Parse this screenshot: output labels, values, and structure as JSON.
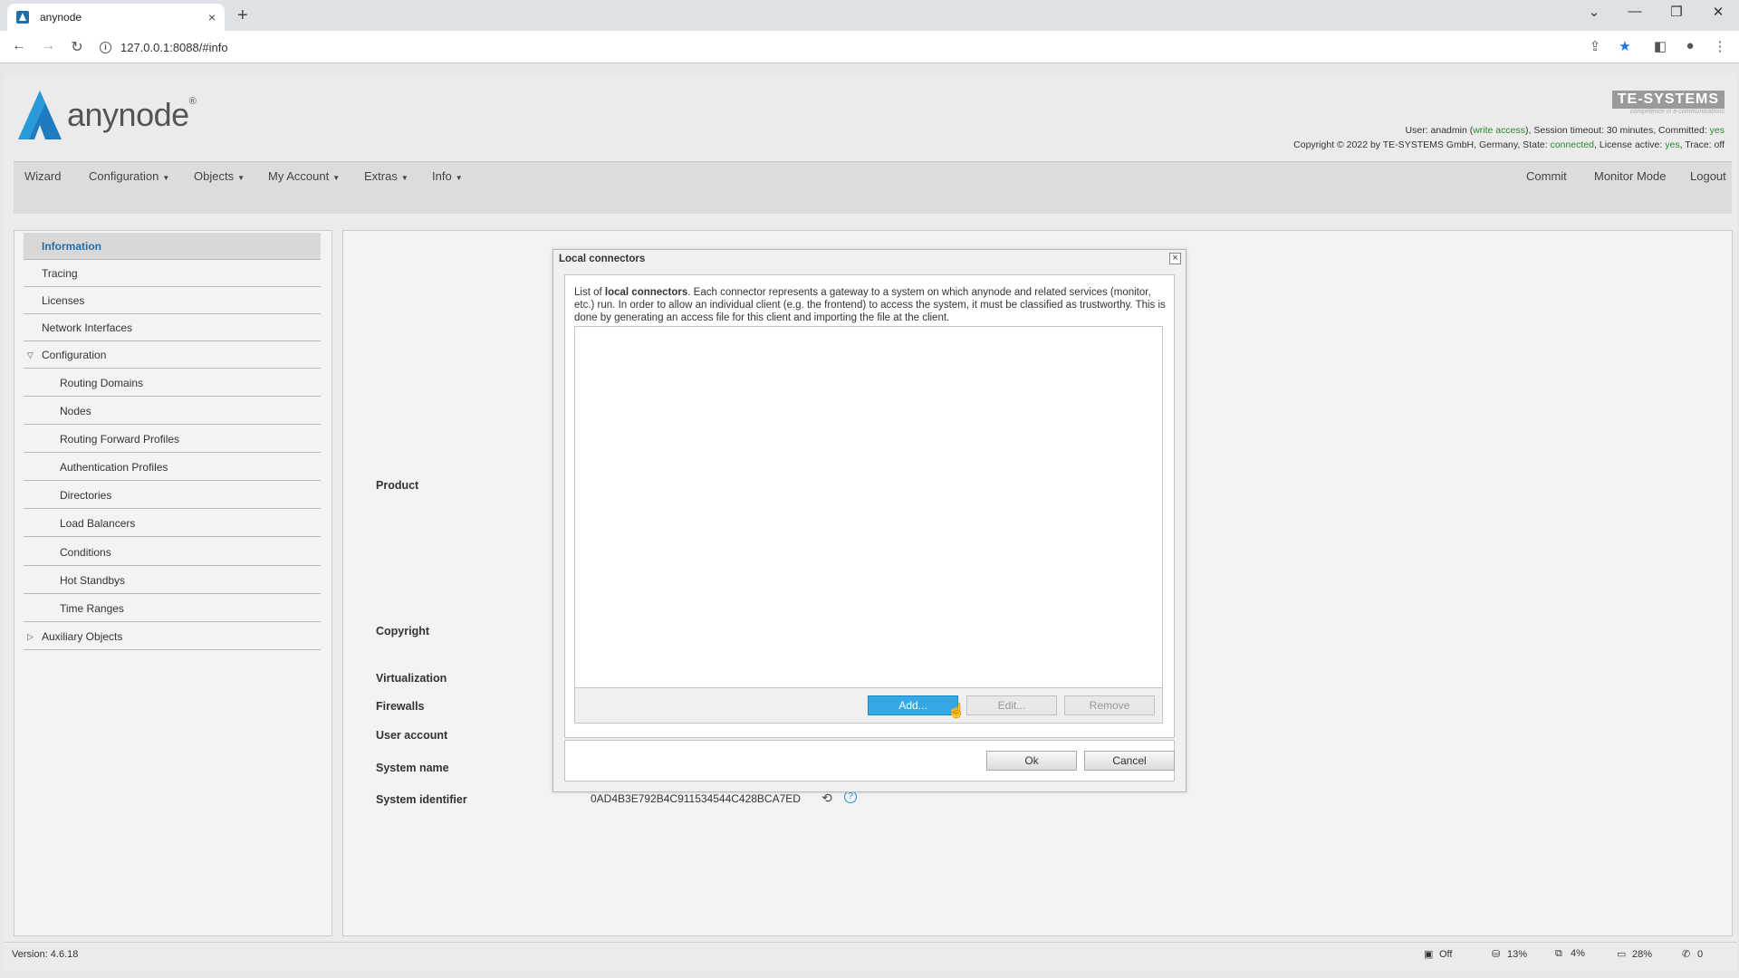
{
  "browser": {
    "tab_title": "anynode",
    "tab_close": "×",
    "new_tab": "+",
    "url": "127.0.0.1:8088/#info",
    "win_min": "—",
    "win_restore": "❐",
    "win_close": "✕",
    "tab_list": "⌄"
  },
  "header": {
    "logo_text": "anynode",
    "logo_reg": "®",
    "te_name": "TE-SYSTEMS",
    "te_tagline": "competence in e-communications",
    "status_line1_prefix": "User: anadmin (",
    "write_access": "write access",
    "status_line1_mid": "), Session timeout: 30 minutes, Committed: ",
    "committed_value": "yes",
    "status_line2_prefix": "Copyright © 2022 by TE-SYSTEMS GmbH, Germany, State: ",
    "state_value": "connected",
    "status_line2_mid": ", License active: ",
    "license_value": "yes",
    "status_line2_suffix": ", Trace: off"
  },
  "menu": {
    "wizard": "Wizard",
    "configuration": "Configuration",
    "objects": "Objects",
    "my_account": "My Account",
    "extras": "Extras",
    "info": "Info",
    "commit": "Commit",
    "monitor_mode": "Monitor Mode",
    "logout": "Logout"
  },
  "sidebar": {
    "items": [
      {
        "label": "Information"
      },
      {
        "label": "Tracing"
      },
      {
        "label": "Licenses"
      },
      {
        "label": "Network Interfaces"
      },
      {
        "label": "Configuration"
      },
      {
        "label": "Routing Domains"
      },
      {
        "label": "Nodes"
      },
      {
        "label": "Routing Forward Profiles"
      },
      {
        "label": "Authentication Profiles"
      },
      {
        "label": "Directories"
      },
      {
        "label": "Load Balancers"
      },
      {
        "label": "Conditions"
      },
      {
        "label": "Hot Standbys"
      },
      {
        "label": "Time Ranges"
      },
      {
        "label": "Auxiliary Objects"
      }
    ]
  },
  "info": {
    "product_label": "Product",
    "copyright_label": "Copyright",
    "virtualization_label": "Virtualization",
    "firewalls_label": "Firewalls",
    "user_account_label": "User account",
    "system_name_label": "System name",
    "system_identifier_label": "System identifier",
    "system_identifier_value": "0AD4B3E792B4C911534544C428BCA7ED"
  },
  "dialog": {
    "title": "Local connectors",
    "close": "×",
    "desc_prefix": "List of ",
    "desc_bold": "local connectors",
    "desc_rest": ". Each connector represents a gateway to a system on which anynode and related services (monitor, etc.) run. In order to allow an individual client (e.g. the frontend) to access the system, it must be classified as trustworthy. This is done by generating an access file for this client and importing the file at the client.",
    "add": "Add...",
    "edit": "Edit...",
    "remove": "Remove",
    "ok": "Ok",
    "cancel": "Cancel"
  },
  "statusbar": {
    "version": "Version: 4.6.18",
    "monitor": "Off",
    "disk": "13%",
    "cpu": "4%",
    "memory": "28%",
    "calls": "0"
  },
  "colors": {
    "accent": "#1e6fb0",
    "primary_button": "#35a7e4",
    "ok_green": "#2a8a2a"
  }
}
